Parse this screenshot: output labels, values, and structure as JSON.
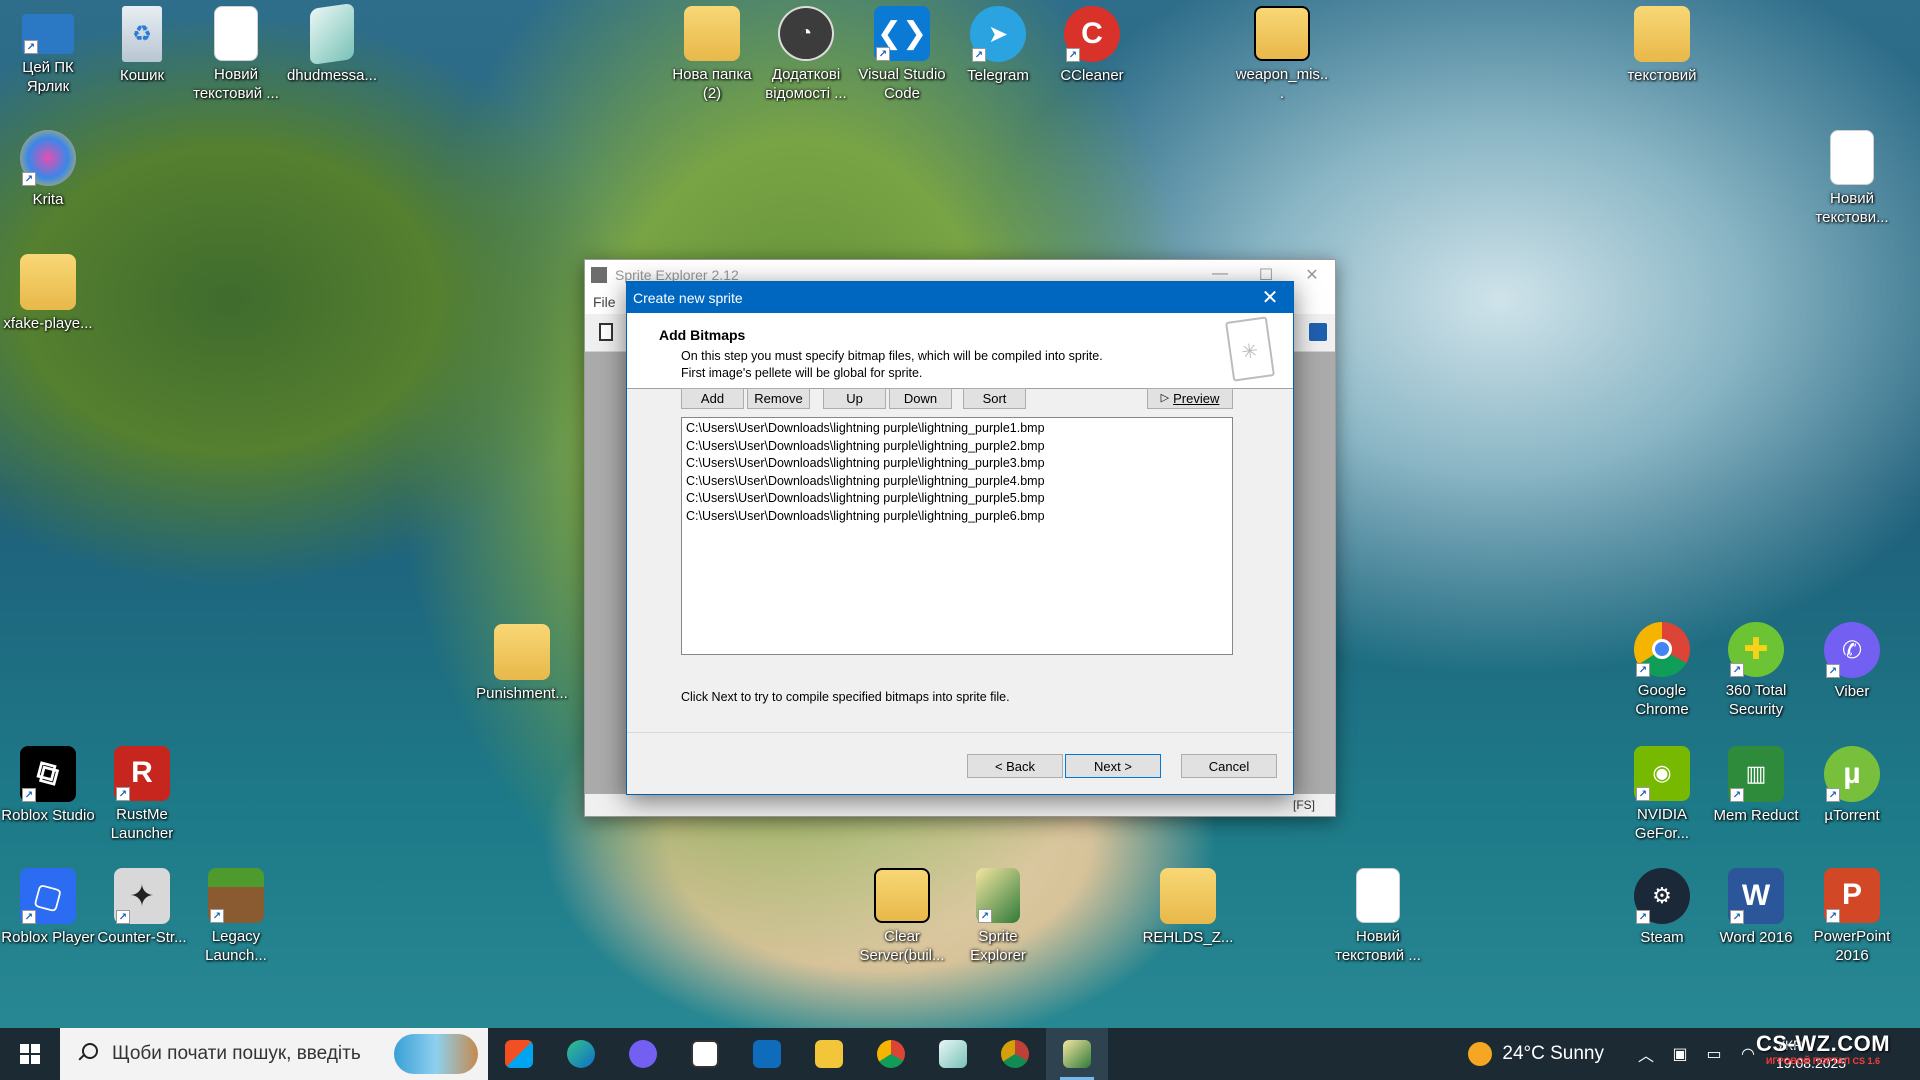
{
  "desktop": {
    "icons": {
      "this_pc": "Цей ПК\nЯрлик",
      "recycle": "Кошик",
      "new_text_1": "Новий текстовий ...",
      "dhudmessage": "dhudmessa...",
      "new_folder_2": "Нова папка (2)",
      "additional_info": "Додаткові відомості ...",
      "vscode": "Visual Studio Code",
      "telegram": "Telegram",
      "ccleaner": "CCleaner",
      "weapon_mis": "weapon_mis...",
      "text_folder": "текстовий",
      "new_text_2": "Новий текстови...",
      "krita": "Krita",
      "xfake": "xfake-playe...",
      "punishment": "Punishment...",
      "roblox_studio": "Roblox Studio",
      "rustme": "RustMe Launcher",
      "roblox_player": "Roblox Player",
      "counter_strike": "Counter-Str...",
      "legacy_launcher": "Legacy Launch...",
      "clear_server": "Clear Server(buil...",
      "sprite_explorer": "Sprite Explorer",
      "rehlds": "REHLDS_Z...",
      "new_text_3": "Новий текстовий ...",
      "chrome": "Google Chrome",
      "total_security": "360 Total Security",
      "viber": "Viber",
      "nvidia": "NVIDIA GeFor...",
      "mem_reduct": "Mem Reduct",
      "utorrent": "µTorrent",
      "steam": "Steam",
      "word": "Word 2016",
      "powerpoint": "PowerPoint 2016"
    }
  },
  "main_window": {
    "title": "Sprite Explorer 2.12",
    "menu_file": "File",
    "status_text": "[FS]"
  },
  "dialog": {
    "title": "Create new sprite",
    "close_glyph": "✕",
    "step_title": "Add Bitmaps",
    "step_desc_1": "On this step you must specify bitmap files, which will be compiled into sprite.",
    "step_desc_2": "First image's pellete will be global for sprite.",
    "buttons": {
      "add": "Add",
      "remove": "Remove",
      "up": "Up",
      "down": "Down",
      "sort": "Sort",
      "preview": "Preview",
      "back": "< Back",
      "next": "Next >",
      "cancel": "Cancel"
    },
    "files": [
      "C:\\Users\\User\\Downloads\\lightning purple\\lightning_purple1.bmp",
      "C:\\Users\\User\\Downloads\\lightning purple\\lightning_purple2.bmp",
      "C:\\Users\\User\\Downloads\\lightning purple\\lightning_purple3.bmp",
      "C:\\Users\\User\\Downloads\\lightning purple\\lightning_purple4.bmp",
      "C:\\Users\\User\\Downloads\\lightning purple\\lightning_purple5.bmp",
      "C:\\Users\\User\\Downloads\\lightning purple\\lightning_purple6.bmp"
    ],
    "hint": "Click Next to try to compile specified bitmaps into sprite file."
  },
  "taskbar": {
    "search_placeholder": "Щоби почати пошук, введіть",
    "weather": "24°C  Sunny",
    "language": "УКР",
    "date": "19.08.2025",
    "watermark_main": "CS-WZ.COM",
    "watermark_sub": "ИГРОВОЙ ПОРТАЛ CS 1.6"
  },
  "colors": {
    "accent": "#0067c0",
    "taskbar": "#1c2a33"
  }
}
